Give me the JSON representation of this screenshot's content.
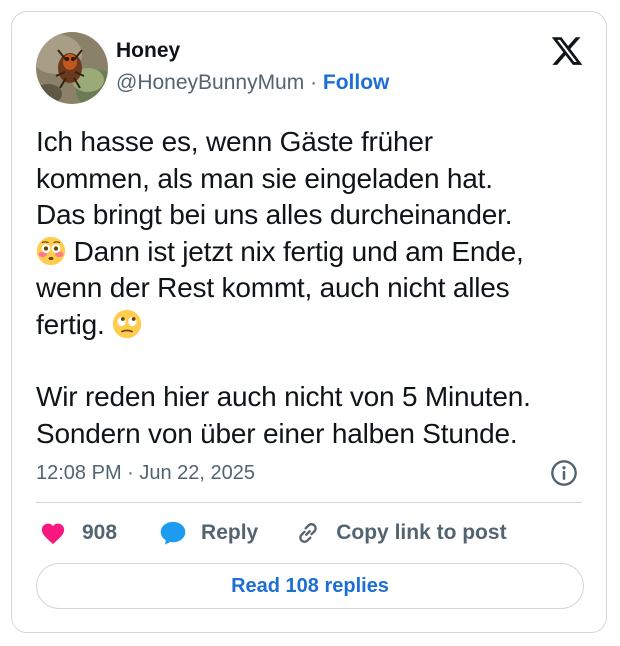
{
  "author": {
    "name": "Honey",
    "handle": "@HoneyBunnyMum",
    "separator": " · ",
    "follow_label": "Follow"
  },
  "tweet": {
    "paragraph1": {
      "line1": "Ich hasse es, wenn Gäste früher",
      "line2": "kommen, als man sie eingeladen hat.",
      "line3": "Das bringt bei uns alles durcheinander.",
      "line4_after_emoji": " Dann ist jetzt nix fertig und am Ende,",
      "line5": "wenn der Rest kommt, auch nicht alles",
      "line6_before_emoji": "fertig. "
    },
    "paragraph2": {
      "line1": "Wir reden hier auch nicht von 5 Minuten.",
      "line2": "Sondern von über einer halben Stunde."
    },
    "emojis": [
      "flushed-face",
      "face-with-rolling-eyes"
    ],
    "timestamp": "12:08 PM · Jun 22, 2025"
  },
  "actions": {
    "like_count": "908",
    "reply_label": "Reply",
    "copy_link_label": "Copy link to post"
  },
  "read_replies_label": "Read 108 replies",
  "colors": {
    "link_blue": "#1d6fd6",
    "heart_pink": "#f91880",
    "reply_blue": "#1d9bf0",
    "muted_text": "#536471",
    "border": "#cfd9de"
  }
}
